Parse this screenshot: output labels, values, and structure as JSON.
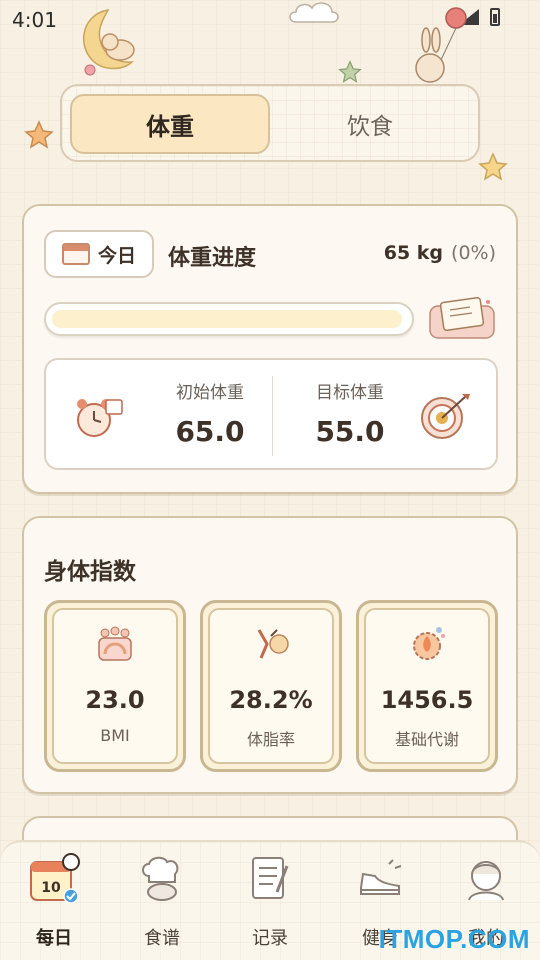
{
  "status_bar": {
    "time": "4:01"
  },
  "toggle": {
    "active": "体重",
    "inactive": "饮食"
  },
  "weight_card": {
    "today_label": "今日",
    "title": "体重进度",
    "current": "65 kg",
    "percent": "(0%)",
    "progress": 0,
    "initial_label": "初始体重",
    "initial_value": "65.0",
    "target_label": "目标体重",
    "target_value": "55.0"
  },
  "body_card": {
    "title": "身体指数",
    "metrics": [
      {
        "value": "23.0",
        "label": "BMI",
        "icon": "bmi-scale-icon"
      },
      {
        "value": "28.2%",
        "label": "体脂率",
        "icon": "body-fat-icon"
      },
      {
        "value": "1456.5",
        "label": "基础代谢",
        "icon": "metabolism-icon"
      }
    ]
  },
  "nav": [
    {
      "label": "每日",
      "icon": "calendar-icon",
      "active": true
    },
    {
      "label": "食谱",
      "icon": "chef-icon",
      "active": false
    },
    {
      "label": "记录",
      "icon": "notebook-icon",
      "active": false
    },
    {
      "label": "健身",
      "icon": "sneaker-icon",
      "active": false
    },
    {
      "label": "我的",
      "icon": "profile-icon",
      "active": false
    }
  ],
  "calendar_badge": "10",
  "watermark": "ITMOP.COM",
  "colors": {
    "accent": "#fbe7c2",
    "card": "#fdf9f2",
    "border": "#d3c3a6",
    "watermark": "#2aa3e3"
  }
}
